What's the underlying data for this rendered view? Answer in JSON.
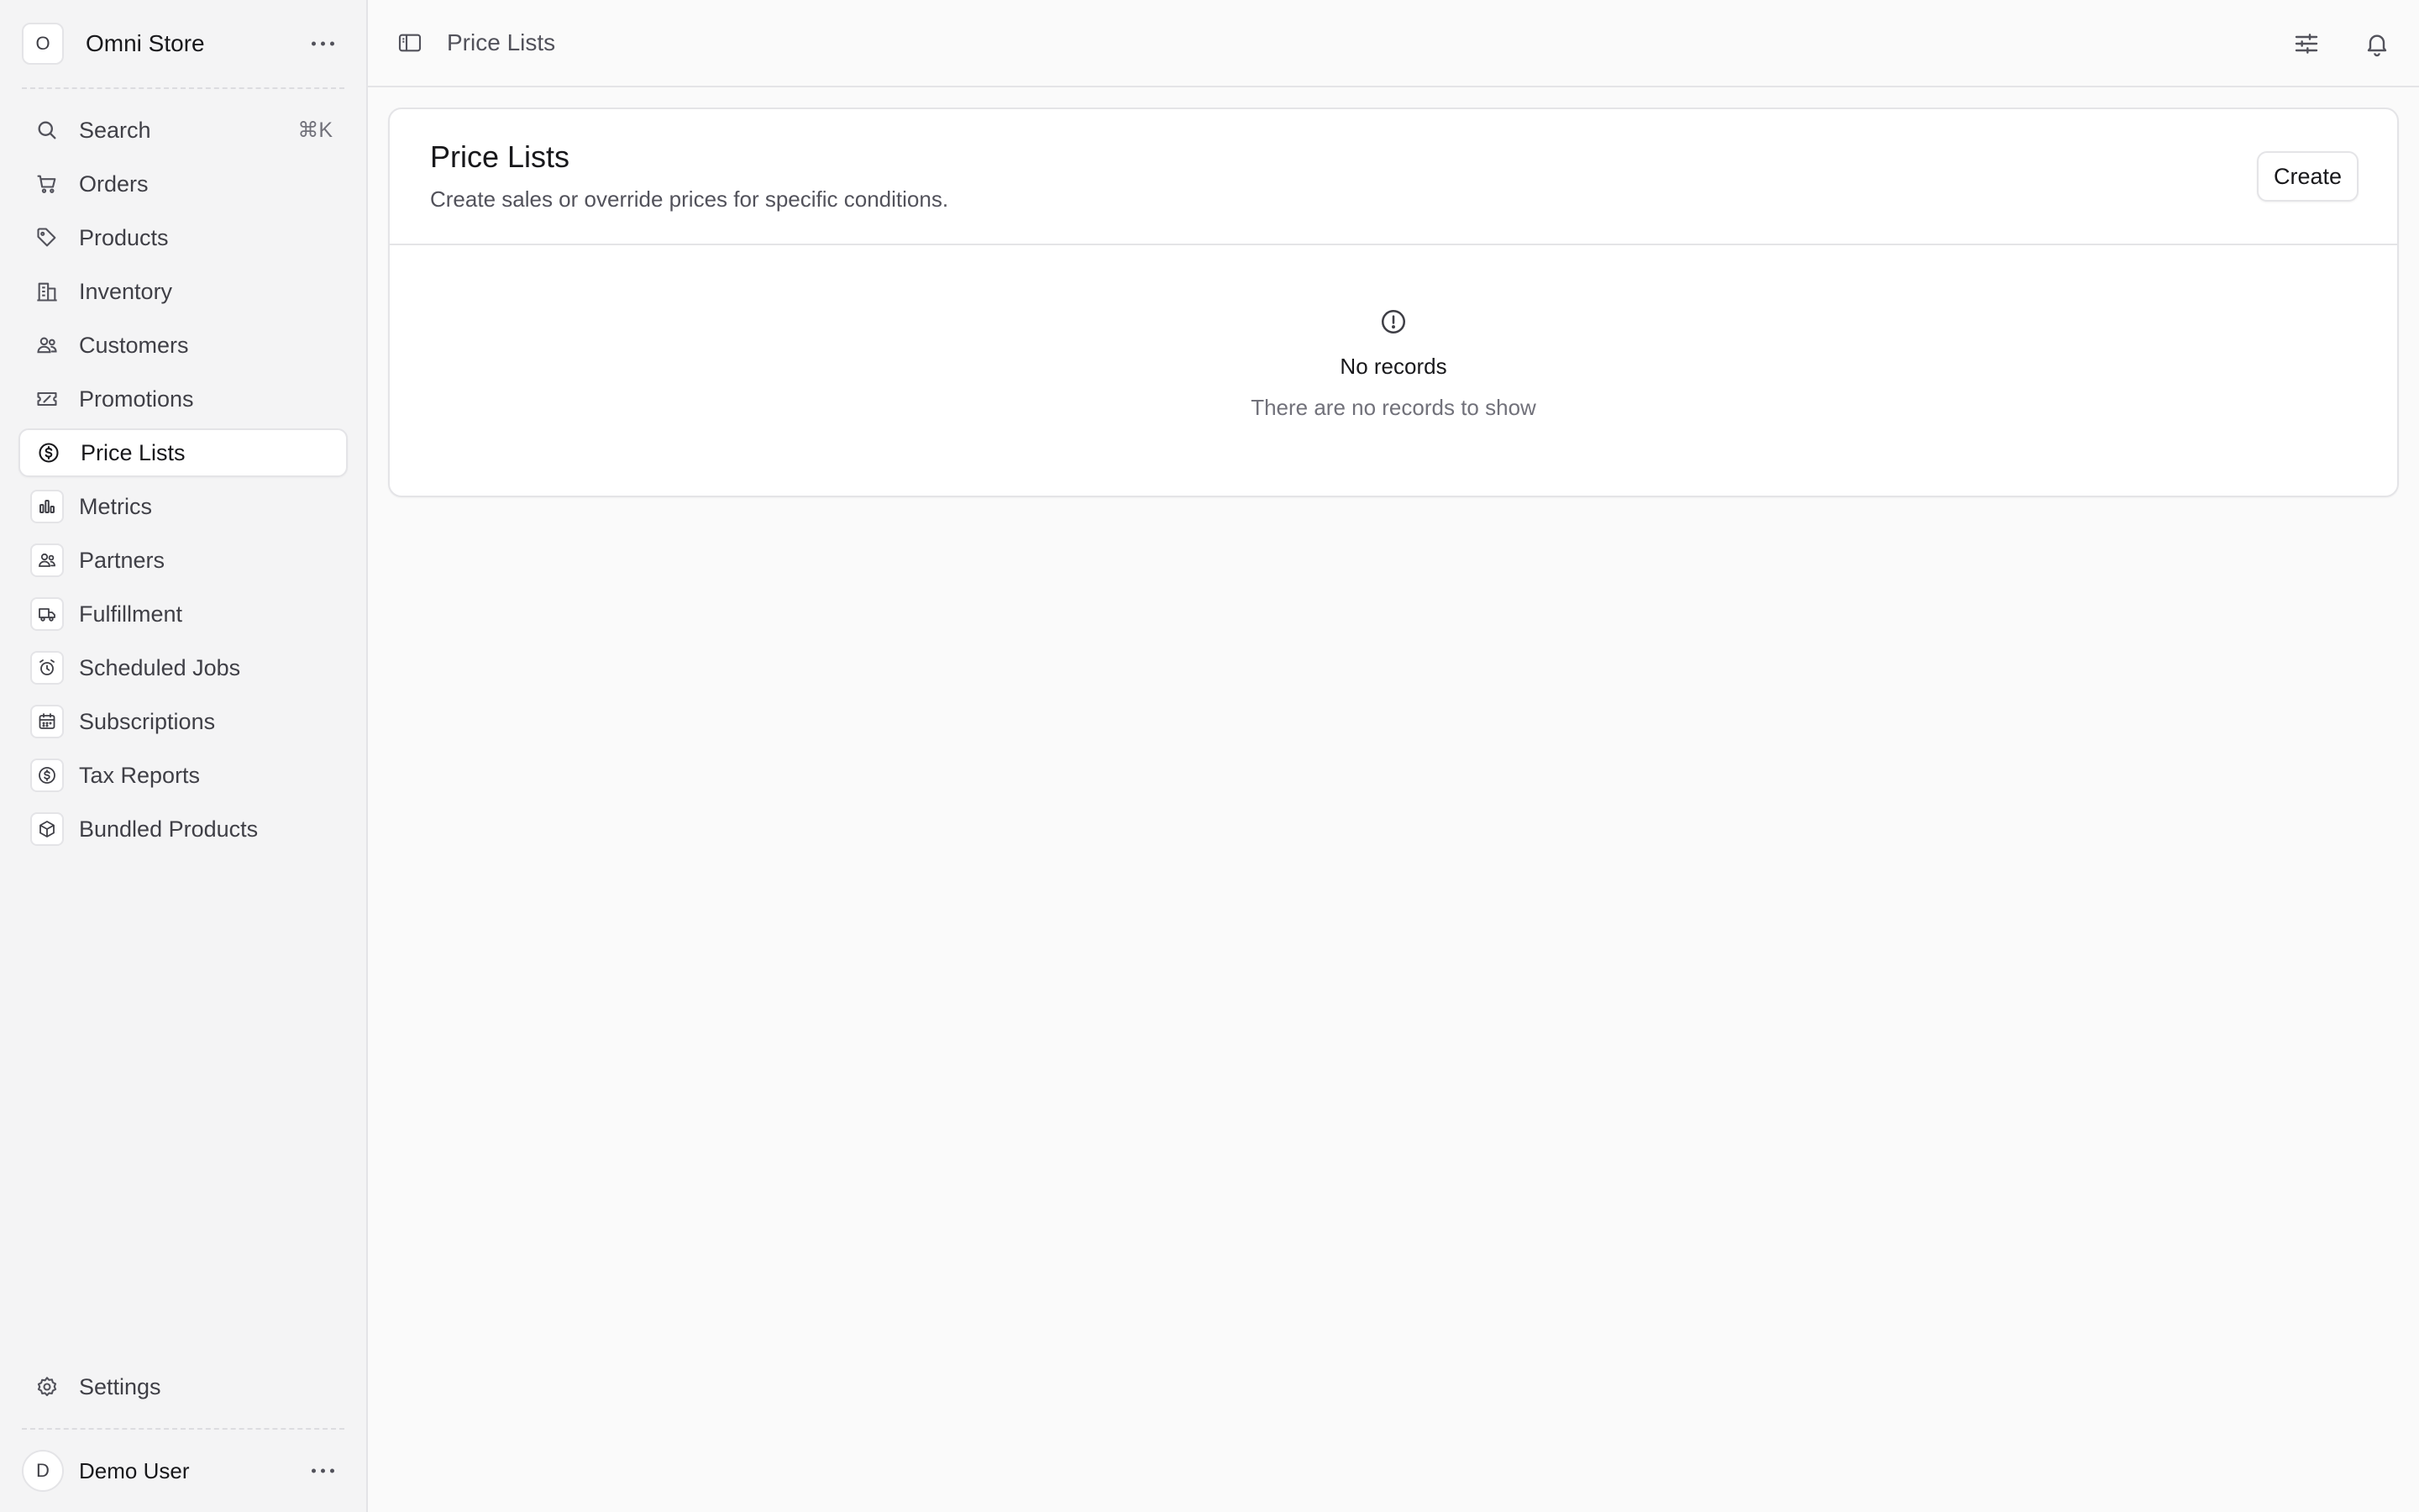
{
  "store": {
    "avatar_letter": "O",
    "name": "Omni Store"
  },
  "search": {
    "label": "Search",
    "shortcut": "⌘K"
  },
  "sidebar": {
    "items": [
      {
        "label": "Orders",
        "icon": "cart-icon"
      },
      {
        "label": "Products",
        "icon": "tag-icon"
      },
      {
        "label": "Inventory",
        "icon": "building-icon"
      },
      {
        "label": "Customers",
        "icon": "users-icon"
      },
      {
        "label": "Promotions",
        "icon": "receipt-percent-icon"
      },
      {
        "label": "Price Lists",
        "icon": "currency-dollar-icon",
        "active": true
      }
    ],
    "extensions": [
      {
        "label": "Metrics",
        "icon": "bar-chart-icon"
      },
      {
        "label": "Partners",
        "icon": "users-icon"
      },
      {
        "label": "Fulfillment",
        "icon": "truck-icon"
      },
      {
        "label": "Scheduled Jobs",
        "icon": "alarm-clock-icon"
      },
      {
        "label": "Subscriptions",
        "icon": "calendar-icon"
      },
      {
        "label": "Tax Reports",
        "icon": "currency-dollar-icon"
      },
      {
        "label": "Bundled Products",
        "icon": "cube-icon"
      }
    ],
    "settings_label": "Settings"
  },
  "user": {
    "avatar_letter": "D",
    "name": "Demo User"
  },
  "topbar": {
    "breadcrumb": "Price Lists"
  },
  "page": {
    "title": "Price Lists",
    "subtitle": "Create sales or override prices for specific conditions.",
    "create_label": "Create"
  },
  "empty_state": {
    "title": "No records",
    "subtitle": "There are no records to show",
    "icon": "exclamation-circle-icon"
  },
  "colors": {
    "accent_text": "#18181b",
    "muted_text": "#71717a",
    "border": "#e4e4e7",
    "background": "#fafafa"
  }
}
